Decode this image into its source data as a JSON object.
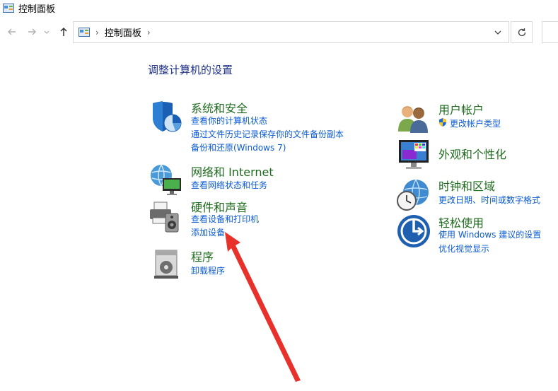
{
  "window": {
    "title": "控制面板"
  },
  "address_bar": {
    "breadcrumb": "控制面板"
  },
  "heading": "调整计算机的设置",
  "categories_left": [
    {
      "title": "系统和安全",
      "links": [
        "查看你的计算机状态",
        "通过文件历史记录保存你的文件备份副本",
        "备份和还原(Windows 7)"
      ]
    },
    {
      "title": "网络和 Internet",
      "links": [
        "查看网络状态和任务"
      ]
    },
    {
      "title": "硬件和声音",
      "links": [
        "查看设备和打印机",
        "添加设备"
      ]
    },
    {
      "title": "程序",
      "links": [
        "卸载程序"
      ]
    }
  ],
  "categories_right": [
    {
      "title": "用户帐户",
      "links": [
        "更改帐户类型"
      ]
    },
    {
      "title": "外观和个性化",
      "links": []
    },
    {
      "title": "时钟和区域",
      "links": [
        "更改日期、时间或数字格式"
      ]
    },
    {
      "title": "轻松使用",
      "links": [
        "使用 Windows 建议的设置",
        "优化视觉显示"
      ]
    }
  ],
  "colors": {
    "accent_link": "#0b5bd3",
    "category_title": "#1e6b1e",
    "heading": "#1e3287",
    "annotation_arrow": "#e8312a"
  }
}
